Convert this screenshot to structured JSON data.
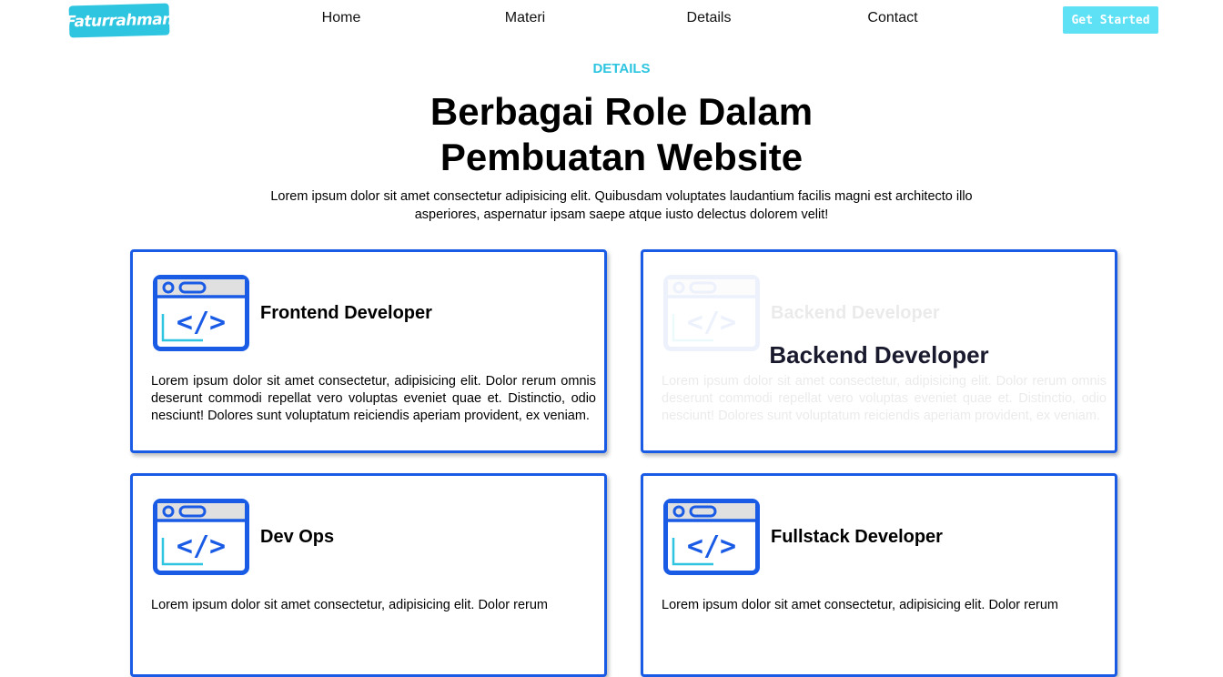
{
  "nav": {
    "logo": "Faturrahman",
    "links": [
      "Home",
      "Materi",
      "Details",
      "Contact"
    ],
    "cta": "Get Started"
  },
  "hero": {
    "eyebrow": "DETAILS",
    "title": "Berbagai Role Dalam Pembuatan Website",
    "description": "Lorem ipsum dolor sit amet consectetur adipisicing elit. Quibusdam voluptates laudantium facilis magni est architecto illo asperiores, aspernatur ipsam saepe atque iusto delectus dolorem velit!"
  },
  "cards": [
    {
      "title": "Frontend Developer",
      "text": "Lorem ipsum dolor sit amet consectetur, adipisicing elit. Dolor rerum omnis deserunt commodi repellat vero voluptas eveniet quae et. Distinctio, odio nesciunt! Dolores sunt voluptatum reiciendis aperiam provident, ex veniam.",
      "icon": "code-window-icon"
    },
    {
      "title": "Backend Developer",
      "text": "Lorem ipsum dolor sit amet consectetur, adipisicing elit. Dolor rerum omnis deserunt commodi repellat vero voluptas eveniet quae et. Distinctio, odio nesciunt! Dolores sunt voluptatum reiciendis aperiam provident, ex veniam.",
      "icon": "code-window-icon",
      "hover_title": "Backend Developer"
    },
    {
      "title": "Dev Ops",
      "text": "Lorem ipsum dolor sit amet consectetur, adipisicing elit. Dolor rerum",
      "icon": "code-window-icon"
    },
    {
      "title": "Fullstack Developer",
      "text": "Lorem ipsum dolor sit amet consectetur, adipisicing elit. Dolor rerum",
      "icon": "code-window-icon"
    }
  ],
  "colors": {
    "accent": "#2ec5e0",
    "card_border": "#1a5be6",
    "cta_bg": "#5ee1f5"
  }
}
